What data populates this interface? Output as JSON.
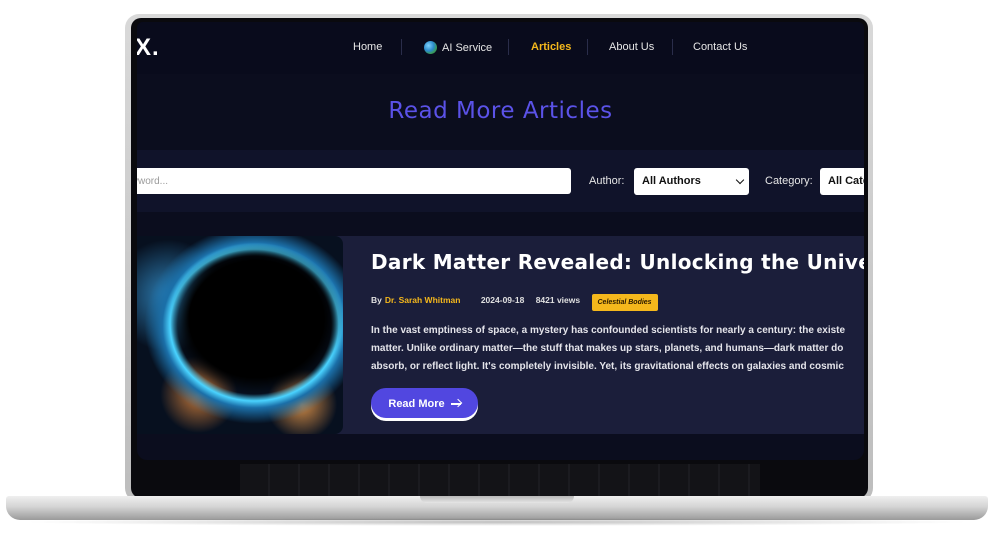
{
  "nav": {
    "logo": "X.",
    "items": [
      {
        "label": "Home",
        "active": false
      },
      {
        "label": "AI Service",
        "active": false,
        "icon": "globe-icon"
      },
      {
        "label": "Articles",
        "active": true
      },
      {
        "label": "About Us",
        "active": false
      },
      {
        "label": "Contact Us",
        "active": false
      }
    ]
  },
  "page": {
    "title": "Read More Articles"
  },
  "filters": {
    "search_placeholder": "yword...",
    "author_label": "Author:",
    "author_value": "All Authors",
    "category_label": "Category:",
    "category_value": "All Cate"
  },
  "article": {
    "title": "Dark Matter Revealed: Unlocking the Universe's",
    "by": "By",
    "author": "Dr. Sarah Whitman",
    "date": "2024-09-18",
    "views": "8421 views",
    "category": "Celestial Bodies",
    "excerpt_lines": [
      "In the vast emptiness of space, a mystery has confounded scientists for nearly a century: the existe",
      "matter. Unlike ordinary matter—the stuff that makes up stars, planets, and humans—dark matter do",
      "absorb, or reflect light. It's completely invisible. Yet, its gravitational effects on galaxies and cosmic"
    ],
    "read_more_label": "Read More"
  },
  "colors": {
    "accent": "#5147e0",
    "highlight": "#f5b81c",
    "background": "#0b0d1e"
  }
}
